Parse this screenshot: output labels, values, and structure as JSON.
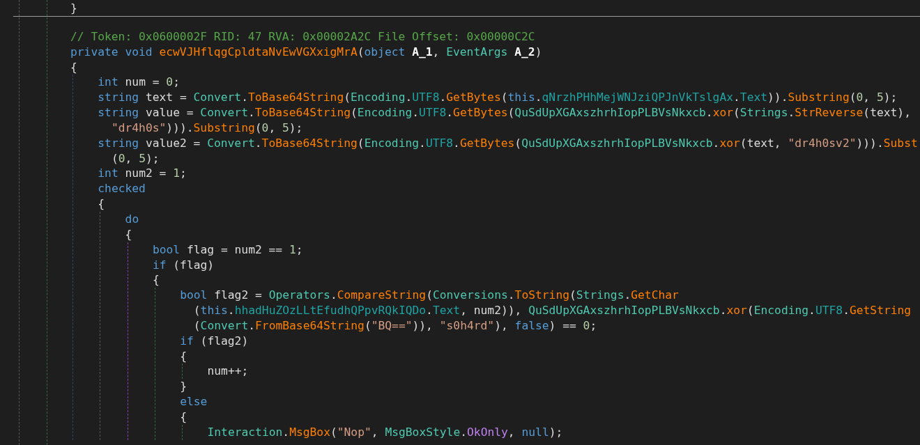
{
  "editor": {
    "lines": [
      {
        "kind": "code",
        "tokens": [
          {
            "t": "}",
            "kind": "plain"
          }
        ]
      },
      {
        "kind": "separator"
      },
      {
        "kind": "code",
        "tokens": [
          {
            "t": "// Token: 0x0600002F RID: 47 RVA: 0x00002A2C File Offset: 0x00000C2C",
            "kind": "comment"
          }
        ]
      },
      {
        "kind": "code",
        "tokens": [
          {
            "t": "private ",
            "kind": "keyword"
          },
          {
            "t": "void ",
            "kind": "keyword"
          },
          {
            "t": "ecwVJHflqgCpldtaNvEwVGXxigMrA",
            "kind": "method"
          },
          {
            "t": "(",
            "kind": "plain"
          },
          {
            "t": "object ",
            "kind": "keyword"
          },
          {
            "t": "A_1",
            "kind": "param"
          },
          {
            "t": ", ",
            "kind": "plain"
          },
          {
            "t": "EventArgs ",
            "kind": "type"
          },
          {
            "t": "A_2",
            "kind": "param"
          },
          {
            "t": ")",
            "kind": "plain"
          }
        ]
      },
      {
        "kind": "code",
        "tokens": [
          {
            "t": "{",
            "kind": "plain"
          }
        ],
        "children": [
          {
            "kind": "code",
            "tokens": [
              {
                "t": "int",
                "kind": "keyword"
              },
              {
                "t": " num = ",
                "kind": "plain"
              },
              {
                "t": "0",
                "kind": "number"
              },
              {
                "t": ";",
                "kind": "plain"
              }
            ]
          },
          {
            "kind": "code",
            "tokens": [
              {
                "t": "string",
                "kind": "keyword"
              },
              {
                "t": " text = ",
                "kind": "plain"
              },
              {
                "t": "Convert",
                "kind": "type"
              },
              {
                "t": ".",
                "kind": "plain"
              },
              {
                "t": "ToBase64String",
                "kind": "method"
              },
              {
                "t": "(",
                "kind": "plain"
              },
              {
                "t": "Encoding",
                "kind": "type"
              },
              {
                "t": ".",
                "kind": "plain"
              },
              {
                "t": "UTF8",
                "kind": "field"
              },
              {
                "t": ".",
                "kind": "plain"
              },
              {
                "t": "GetBytes",
                "kind": "method"
              },
              {
                "t": "(",
                "kind": "plain"
              },
              {
                "t": "this",
                "kind": "keyword"
              },
              {
                "t": ".",
                "kind": "plain"
              },
              {
                "t": "qNrzhPHhMejWNJziQPJnVkTslgAx",
                "kind": "field"
              },
              {
                "t": ".",
                "kind": "plain"
              },
              {
                "t": "Text",
                "kind": "field"
              },
              {
                "t": ")).",
                "kind": "plain"
              },
              {
                "t": "Substring",
                "kind": "method"
              },
              {
                "t": "(",
                "kind": "plain"
              },
              {
                "t": "0",
                "kind": "number"
              },
              {
                "t": ", ",
                "kind": "plain"
              },
              {
                "t": "5",
                "kind": "number"
              },
              {
                "t": ");",
                "kind": "plain"
              }
            ]
          },
          {
            "kind": "code",
            "tokens": [
              {
                "t": "string",
                "kind": "keyword"
              },
              {
                "t": " value = ",
                "kind": "plain"
              },
              {
                "t": "Convert",
                "kind": "type"
              },
              {
                "t": ".",
                "kind": "plain"
              },
              {
                "t": "ToBase64String",
                "kind": "method"
              },
              {
                "t": "(",
                "kind": "plain"
              },
              {
                "t": "Encoding",
                "kind": "type"
              },
              {
                "t": ".",
                "kind": "plain"
              },
              {
                "t": "UTF8",
                "kind": "field"
              },
              {
                "t": ".",
                "kind": "plain"
              },
              {
                "t": "GetBytes",
                "kind": "method"
              },
              {
                "t": "(",
                "kind": "plain"
              },
              {
                "t": "QuSdUpXGAxszhrhIopPLBVsNkxcb",
                "kind": "type"
              },
              {
                "t": ".",
                "kind": "plain"
              },
              {
                "t": "xor",
                "kind": "method"
              },
              {
                "t": "(",
                "kind": "plain"
              },
              {
                "t": "Strings",
                "kind": "type"
              },
              {
                "t": ".",
                "kind": "plain"
              },
              {
                "t": "StrReverse",
                "kind": "method"
              },
              {
                "t": "(text),",
                "kind": "plain"
              }
            ]
          },
          {
            "kind": "continuation",
            "tokens": [
              {
                "t": "\"dr4h0s\"",
                "kind": "string"
              },
              {
                "t": "))).",
                "kind": "plain"
              },
              {
                "t": "Substring",
                "kind": "method"
              },
              {
                "t": "(",
                "kind": "plain"
              },
              {
                "t": "0",
                "kind": "number"
              },
              {
                "t": ", ",
                "kind": "plain"
              },
              {
                "t": "5",
                "kind": "number"
              },
              {
                "t": ");",
                "kind": "plain"
              }
            ]
          },
          {
            "kind": "code",
            "tokens": [
              {
                "t": "string",
                "kind": "keyword"
              },
              {
                "t": " value2 = ",
                "kind": "plain"
              },
              {
                "t": "Convert",
                "kind": "type"
              },
              {
                "t": ".",
                "kind": "plain"
              },
              {
                "t": "ToBase64String",
                "kind": "method"
              },
              {
                "t": "(",
                "kind": "plain"
              },
              {
                "t": "Encoding",
                "kind": "type"
              },
              {
                "t": ".",
                "kind": "plain"
              },
              {
                "t": "UTF8",
                "kind": "field"
              },
              {
                "t": ".",
                "kind": "plain"
              },
              {
                "t": "GetBytes",
                "kind": "method"
              },
              {
                "t": "(",
                "kind": "plain"
              },
              {
                "t": "QuSdUpXGAxszhrhIopPLBVsNkxcb",
                "kind": "type"
              },
              {
                "t": ".",
                "kind": "plain"
              },
              {
                "t": "xor",
                "kind": "method"
              },
              {
                "t": "(text, ",
                "kind": "plain"
              },
              {
                "t": "\"dr4h0sv2\"",
                "kind": "string"
              },
              {
                "t": "))).",
                "kind": "plain"
              },
              {
                "t": "Subst",
                "kind": "method"
              }
            ]
          },
          {
            "kind": "continuation",
            "tokens": [
              {
                "t": "(",
                "kind": "plain"
              },
              {
                "t": "0",
                "kind": "number"
              },
              {
                "t": ", ",
                "kind": "plain"
              },
              {
                "t": "5",
                "kind": "number"
              },
              {
                "t": ");",
                "kind": "plain"
              }
            ]
          },
          {
            "kind": "code",
            "tokens": [
              {
                "t": "int",
                "kind": "keyword"
              },
              {
                "t": " num2 = ",
                "kind": "plain"
              },
              {
                "t": "1",
                "kind": "number"
              },
              {
                "t": ";",
                "kind": "plain"
              }
            ]
          },
          {
            "kind": "code",
            "tokens": [
              {
                "t": "checked",
                "kind": "keyword"
              }
            ]
          },
          {
            "kind": "code",
            "tokens": [
              {
                "t": "{",
                "kind": "plain"
              }
            ],
            "children": [
              {
                "kind": "code",
                "tokens": [
                  {
                    "t": "do",
                    "kind": "keyword"
                  }
                ]
              },
              {
                "kind": "code",
                "tokens": [
                  {
                    "t": "{",
                    "kind": "plain"
                  }
                ],
                "children": [
                  {
                    "kind": "code",
                    "tokens": [
                      {
                        "t": "bool",
                        "kind": "keyword"
                      },
                      {
                        "t": " flag = num2 == ",
                        "kind": "plain"
                      },
                      {
                        "t": "1",
                        "kind": "number"
                      },
                      {
                        "t": ";",
                        "kind": "plain"
                      }
                    ]
                  },
                  {
                    "kind": "code",
                    "tokens": [
                      {
                        "t": "if",
                        "kind": "keyword"
                      },
                      {
                        "t": " (flag)",
                        "kind": "plain"
                      }
                    ]
                  },
                  {
                    "kind": "code",
                    "tokens": [
                      {
                        "t": "{",
                        "kind": "plain"
                      }
                    ],
                    "children": [
                      {
                        "kind": "code",
                        "tokens": [
                          {
                            "t": "bool",
                            "kind": "keyword"
                          },
                          {
                            "t": " flag2 = ",
                            "kind": "plain"
                          },
                          {
                            "t": "Operators",
                            "kind": "type"
                          },
                          {
                            "t": ".",
                            "kind": "plain"
                          },
                          {
                            "t": "CompareString",
                            "kind": "method"
                          },
                          {
                            "t": "(",
                            "kind": "plain"
                          },
                          {
                            "t": "Conversions",
                            "kind": "type"
                          },
                          {
                            "t": ".",
                            "kind": "plain"
                          },
                          {
                            "t": "ToString",
                            "kind": "method"
                          },
                          {
                            "t": "(",
                            "kind": "plain"
                          },
                          {
                            "t": "Strings",
                            "kind": "type"
                          },
                          {
                            "t": ".",
                            "kind": "plain"
                          },
                          {
                            "t": "GetChar",
                            "kind": "method"
                          }
                        ]
                      },
                      {
                        "kind": "continuation",
                        "tokens": [
                          {
                            "t": "(",
                            "kind": "plain"
                          },
                          {
                            "t": "this",
                            "kind": "keyword"
                          },
                          {
                            "t": ".",
                            "kind": "plain"
                          },
                          {
                            "t": "hhadHuZOzLLtEfudhQPpvRQkIQDo",
                            "kind": "field"
                          },
                          {
                            "t": ".",
                            "kind": "plain"
                          },
                          {
                            "t": "Text",
                            "kind": "field"
                          },
                          {
                            "t": ", num2)), ",
                            "kind": "plain"
                          },
                          {
                            "t": "QuSdUpXGAxszhrhIopPLBVsNkxcb",
                            "kind": "type"
                          },
                          {
                            "t": ".",
                            "kind": "plain"
                          },
                          {
                            "t": "xor",
                            "kind": "method"
                          },
                          {
                            "t": "(",
                            "kind": "plain"
                          },
                          {
                            "t": "Encoding",
                            "kind": "type"
                          },
                          {
                            "t": ".",
                            "kind": "plain"
                          },
                          {
                            "t": "UTF8",
                            "kind": "field"
                          },
                          {
                            "t": ".",
                            "kind": "plain"
                          },
                          {
                            "t": "GetString",
                            "kind": "method"
                          }
                        ]
                      },
                      {
                        "kind": "continuation",
                        "tokens": [
                          {
                            "t": "(",
                            "kind": "plain"
                          },
                          {
                            "t": "Convert",
                            "kind": "type"
                          },
                          {
                            "t": ".",
                            "kind": "plain"
                          },
                          {
                            "t": "FromBase64String",
                            "kind": "method"
                          },
                          {
                            "t": "(",
                            "kind": "plain"
                          },
                          {
                            "t": "\"BQ==\"",
                            "kind": "string"
                          },
                          {
                            "t": ")), ",
                            "kind": "plain"
                          },
                          {
                            "t": "\"s0h4rd\"",
                            "kind": "string"
                          },
                          {
                            "t": "), ",
                            "kind": "plain"
                          },
                          {
                            "t": "false",
                            "kind": "keyword"
                          },
                          {
                            "t": ") == ",
                            "kind": "plain"
                          },
                          {
                            "t": "0",
                            "kind": "number"
                          },
                          {
                            "t": ";",
                            "kind": "plain"
                          }
                        ]
                      },
                      {
                        "kind": "code",
                        "tokens": [
                          {
                            "t": "if",
                            "kind": "keyword"
                          },
                          {
                            "t": " (flag2)",
                            "kind": "plain"
                          }
                        ]
                      },
                      {
                        "kind": "code",
                        "tokens": [
                          {
                            "t": "{",
                            "kind": "plain"
                          }
                        ],
                        "children": [
                          {
                            "kind": "code",
                            "tokens": [
                              {
                                "t": "num++;",
                                "kind": "plain"
                              }
                            ]
                          }
                        ]
                      },
                      {
                        "kind": "code",
                        "tokens": [
                          {
                            "t": "}",
                            "kind": "plain"
                          }
                        ]
                      },
                      {
                        "kind": "code",
                        "tokens": [
                          {
                            "t": "else",
                            "kind": "keyword"
                          }
                        ]
                      },
                      {
                        "kind": "code",
                        "tokens": [
                          {
                            "t": "{",
                            "kind": "plain"
                          }
                        ],
                        "children": [
                          {
                            "kind": "code",
                            "tokens": [
                              {
                                "t": "Interaction",
                                "kind": "type"
                              },
                              {
                                "t": ".",
                                "kind": "plain"
                              },
                              {
                                "t": "MsgBox",
                                "kind": "method"
                              },
                              {
                                "t": "(",
                                "kind": "plain"
                              },
                              {
                                "t": "\"Nop\"",
                                "kind": "string"
                              },
                              {
                                "t": ", ",
                                "kind": "plain"
                              },
                              {
                                "t": "MsgBoxStyle",
                                "kind": "type"
                              },
                              {
                                "t": ".",
                                "kind": "plain"
                              },
                              {
                                "t": "OkOnly",
                                "kind": "enum"
                              },
                              {
                                "t": ", ",
                                "kind": "plain"
                              },
                              {
                                "t": "null",
                                "kind": "keyword"
                              },
                              {
                                "t": ");",
                                "kind": "plain"
                              }
                            ]
                          }
                        ]
                      }
                    ]
                  }
                ]
              }
            ]
          }
        ]
      }
    ]
  }
}
